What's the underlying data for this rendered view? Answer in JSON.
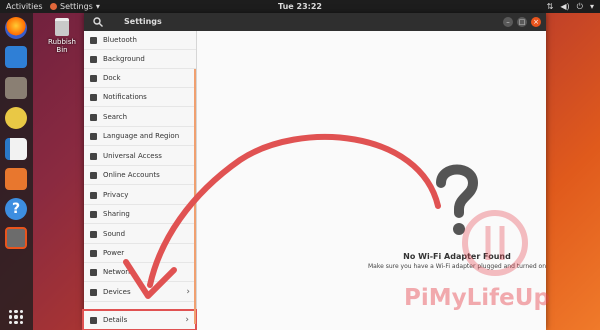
{
  "topbar": {
    "activities": "Activities",
    "app_menu": "Settings",
    "clock": "Tue 23:22",
    "tray_icons": [
      "network-icon",
      "volume-icon",
      "power-icon",
      "chevron-down-icon"
    ]
  },
  "dock": {
    "items": [
      "firefox-icon",
      "thunderbird-icon",
      "files-icon",
      "rhythmbox-icon",
      "writer-icon",
      "software-icon",
      "help-icon",
      "settings-icon"
    ],
    "apps_button_icon": "grid-icon"
  },
  "desktop": {
    "trash_label": "Rubbish Bin"
  },
  "window": {
    "title": "Settings",
    "sidebar": {
      "items": [
        {
          "label": "Bluetooth",
          "icon": "bluetooth-icon"
        },
        {
          "label": "Background",
          "icon": "background-icon"
        },
        {
          "label": "Dock",
          "icon": "dock-icon"
        },
        {
          "label": "Notifications",
          "icon": "bell-icon"
        },
        {
          "label": "Search",
          "icon": "search-icon"
        },
        {
          "label": "Language and Region",
          "icon": "globe-icon"
        },
        {
          "label": "Universal Access",
          "icon": "accessibility-icon"
        },
        {
          "label": "Online Accounts",
          "icon": "cloud-icon"
        },
        {
          "label": "Privacy",
          "icon": "hand-icon"
        },
        {
          "label": "Sharing",
          "icon": "share-icon"
        },
        {
          "label": "Sound",
          "icon": "speaker-icon"
        },
        {
          "label": "Power",
          "icon": "battery-icon"
        },
        {
          "label": "Network",
          "icon": "network-icon"
        },
        {
          "label": "Devices",
          "icon": "printer-icon"
        },
        {
          "label": "Details",
          "icon": "info-icon"
        }
      ],
      "chevron": "›"
    },
    "content": {
      "title": "No Wi-Fi Adapter Found",
      "subtitle": "Make sure you have a Wi-Fi adapter plugged and turned on"
    }
  },
  "watermark": "PiMyLifeUp",
  "colors": {
    "accent": "#e9541d",
    "annotation": "#e05252",
    "headerbar": "#2f2f2f"
  }
}
